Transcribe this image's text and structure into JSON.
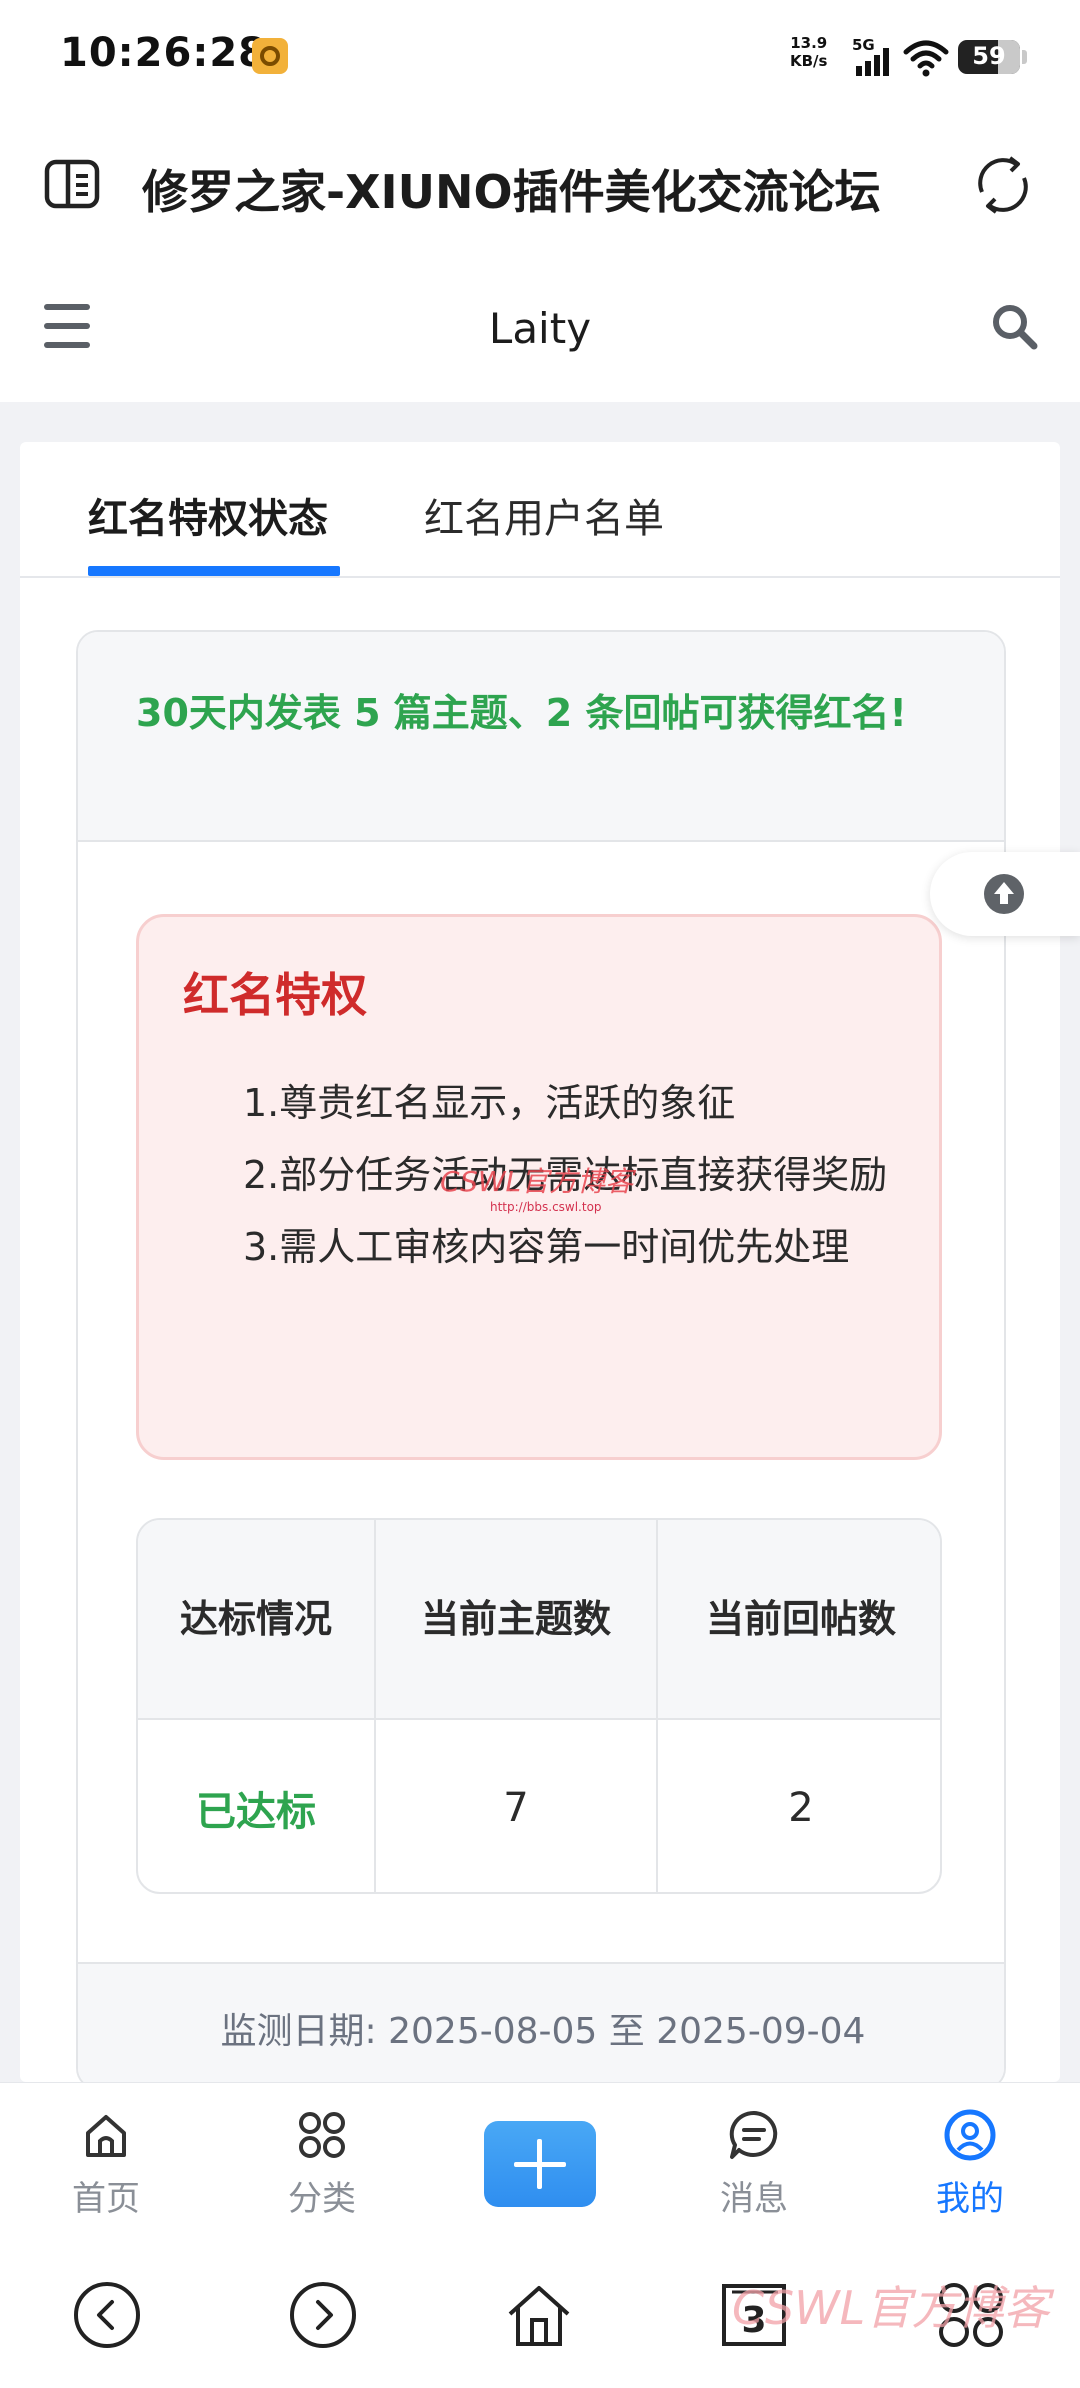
{
  "status_bar": {
    "time": "10:26:28",
    "net_speed_value": "13.9",
    "net_speed_unit": "KB/s",
    "network": "5G",
    "battery": "59"
  },
  "title_bar": {
    "title": "修罗之家-XIUNO插件美化交流论坛"
  },
  "header": {
    "title": "Laity"
  },
  "tabs": [
    {
      "label": "红名特权状态",
      "active": true
    },
    {
      "label": "红名用户名单",
      "active": false
    }
  ],
  "notice": "30天内发表 5 篇主题、2 条回帖可获得红名!",
  "privilege": {
    "title": "红名特权",
    "items": [
      "1.尊贵红名显示，活跃的象征",
      "2.部分任务活动无需达标直接获得奖励",
      "3.需人工审核内容第一时间优先处理"
    ]
  },
  "stats_table": {
    "headers": [
      "达标情况",
      "当前主题数",
      "当前回帖数"
    ],
    "values": [
      "已达标",
      "7",
      "2"
    ]
  },
  "monitor_period": "监测日期: 2025-08-05 至 2025-09-04",
  "watermark": {
    "text": "CSWL官方博客",
    "url": "http://bbs.cswl.top"
  },
  "bottom_nav": [
    {
      "label": "首页",
      "icon": "home-icon"
    },
    {
      "label": "分类",
      "icon": "grid-icon"
    },
    {
      "label": "",
      "icon": "plus-icon"
    },
    {
      "label": "消息",
      "icon": "message-icon"
    },
    {
      "label": "我的",
      "icon": "user-icon",
      "active": true
    }
  ],
  "system_nav": {
    "tabs_count": "3"
  },
  "colors": {
    "accent": "#1677ff",
    "success": "#2ea44f",
    "danger": "#cf2b2b",
    "privilege_bg": "#fdeeee"
  }
}
